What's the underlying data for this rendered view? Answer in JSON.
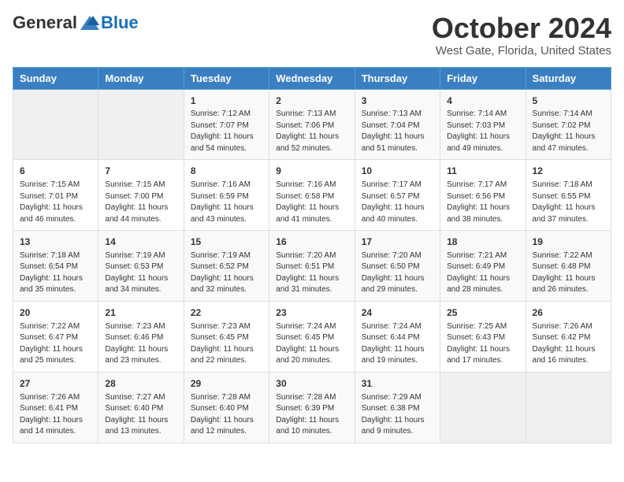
{
  "header": {
    "logo_general": "General",
    "logo_blue": "Blue",
    "month_title": "October 2024",
    "location": "West Gate, Florida, United States"
  },
  "weekdays": [
    "Sunday",
    "Monday",
    "Tuesday",
    "Wednesday",
    "Thursday",
    "Friday",
    "Saturday"
  ],
  "weeks": [
    [
      {
        "day": "",
        "sunrise": "",
        "sunset": "",
        "daylight": ""
      },
      {
        "day": "",
        "sunrise": "",
        "sunset": "",
        "daylight": ""
      },
      {
        "day": "1",
        "sunrise": "Sunrise: 7:12 AM",
        "sunset": "Sunset: 7:07 PM",
        "daylight": "Daylight: 11 hours and 54 minutes."
      },
      {
        "day": "2",
        "sunrise": "Sunrise: 7:13 AM",
        "sunset": "Sunset: 7:06 PM",
        "daylight": "Daylight: 11 hours and 52 minutes."
      },
      {
        "day": "3",
        "sunrise": "Sunrise: 7:13 AM",
        "sunset": "Sunset: 7:04 PM",
        "daylight": "Daylight: 11 hours and 51 minutes."
      },
      {
        "day": "4",
        "sunrise": "Sunrise: 7:14 AM",
        "sunset": "Sunset: 7:03 PM",
        "daylight": "Daylight: 11 hours and 49 minutes."
      },
      {
        "day": "5",
        "sunrise": "Sunrise: 7:14 AM",
        "sunset": "Sunset: 7:02 PM",
        "daylight": "Daylight: 11 hours and 47 minutes."
      }
    ],
    [
      {
        "day": "6",
        "sunrise": "Sunrise: 7:15 AM",
        "sunset": "Sunset: 7:01 PM",
        "daylight": "Daylight: 11 hours and 46 minutes."
      },
      {
        "day": "7",
        "sunrise": "Sunrise: 7:15 AM",
        "sunset": "Sunset: 7:00 PM",
        "daylight": "Daylight: 11 hours and 44 minutes."
      },
      {
        "day": "8",
        "sunrise": "Sunrise: 7:16 AM",
        "sunset": "Sunset: 6:59 PM",
        "daylight": "Daylight: 11 hours and 43 minutes."
      },
      {
        "day": "9",
        "sunrise": "Sunrise: 7:16 AM",
        "sunset": "Sunset: 6:58 PM",
        "daylight": "Daylight: 11 hours and 41 minutes."
      },
      {
        "day": "10",
        "sunrise": "Sunrise: 7:17 AM",
        "sunset": "Sunset: 6:57 PM",
        "daylight": "Daylight: 11 hours and 40 minutes."
      },
      {
        "day": "11",
        "sunrise": "Sunrise: 7:17 AM",
        "sunset": "Sunset: 6:56 PM",
        "daylight": "Daylight: 11 hours and 38 minutes."
      },
      {
        "day": "12",
        "sunrise": "Sunrise: 7:18 AM",
        "sunset": "Sunset: 6:55 PM",
        "daylight": "Daylight: 11 hours and 37 minutes."
      }
    ],
    [
      {
        "day": "13",
        "sunrise": "Sunrise: 7:18 AM",
        "sunset": "Sunset: 6:54 PM",
        "daylight": "Daylight: 11 hours and 35 minutes."
      },
      {
        "day": "14",
        "sunrise": "Sunrise: 7:19 AM",
        "sunset": "Sunset: 6:53 PM",
        "daylight": "Daylight: 11 hours and 34 minutes."
      },
      {
        "day": "15",
        "sunrise": "Sunrise: 7:19 AM",
        "sunset": "Sunset: 6:52 PM",
        "daylight": "Daylight: 11 hours and 32 minutes."
      },
      {
        "day": "16",
        "sunrise": "Sunrise: 7:20 AM",
        "sunset": "Sunset: 6:51 PM",
        "daylight": "Daylight: 11 hours and 31 minutes."
      },
      {
        "day": "17",
        "sunrise": "Sunrise: 7:20 AM",
        "sunset": "Sunset: 6:50 PM",
        "daylight": "Daylight: 11 hours and 29 minutes."
      },
      {
        "day": "18",
        "sunrise": "Sunrise: 7:21 AM",
        "sunset": "Sunset: 6:49 PM",
        "daylight": "Daylight: 11 hours and 28 minutes."
      },
      {
        "day": "19",
        "sunrise": "Sunrise: 7:22 AM",
        "sunset": "Sunset: 6:48 PM",
        "daylight": "Daylight: 11 hours and 26 minutes."
      }
    ],
    [
      {
        "day": "20",
        "sunrise": "Sunrise: 7:22 AM",
        "sunset": "Sunset: 6:47 PM",
        "daylight": "Daylight: 11 hours and 25 minutes."
      },
      {
        "day": "21",
        "sunrise": "Sunrise: 7:23 AM",
        "sunset": "Sunset: 6:46 PM",
        "daylight": "Daylight: 11 hours and 23 minutes."
      },
      {
        "day": "22",
        "sunrise": "Sunrise: 7:23 AM",
        "sunset": "Sunset: 6:45 PM",
        "daylight": "Daylight: 11 hours and 22 minutes."
      },
      {
        "day": "23",
        "sunrise": "Sunrise: 7:24 AM",
        "sunset": "Sunset: 6:45 PM",
        "daylight": "Daylight: 11 hours and 20 minutes."
      },
      {
        "day": "24",
        "sunrise": "Sunrise: 7:24 AM",
        "sunset": "Sunset: 6:44 PM",
        "daylight": "Daylight: 11 hours and 19 minutes."
      },
      {
        "day": "25",
        "sunrise": "Sunrise: 7:25 AM",
        "sunset": "Sunset: 6:43 PM",
        "daylight": "Daylight: 11 hours and 17 minutes."
      },
      {
        "day": "26",
        "sunrise": "Sunrise: 7:26 AM",
        "sunset": "Sunset: 6:42 PM",
        "daylight": "Daylight: 11 hours and 16 minutes."
      }
    ],
    [
      {
        "day": "27",
        "sunrise": "Sunrise: 7:26 AM",
        "sunset": "Sunset: 6:41 PM",
        "daylight": "Daylight: 11 hours and 14 minutes."
      },
      {
        "day": "28",
        "sunrise": "Sunrise: 7:27 AM",
        "sunset": "Sunset: 6:40 PM",
        "daylight": "Daylight: 11 hours and 13 minutes."
      },
      {
        "day": "29",
        "sunrise": "Sunrise: 7:28 AM",
        "sunset": "Sunset: 6:40 PM",
        "daylight": "Daylight: 11 hours and 12 minutes."
      },
      {
        "day": "30",
        "sunrise": "Sunrise: 7:28 AM",
        "sunset": "Sunset: 6:39 PM",
        "daylight": "Daylight: 11 hours and 10 minutes."
      },
      {
        "day": "31",
        "sunrise": "Sunrise: 7:29 AM",
        "sunset": "Sunset: 6:38 PM",
        "daylight": "Daylight: 11 hours and 9 minutes."
      },
      {
        "day": "",
        "sunrise": "",
        "sunset": "",
        "daylight": ""
      },
      {
        "day": "",
        "sunrise": "",
        "sunset": "",
        "daylight": ""
      }
    ]
  ]
}
